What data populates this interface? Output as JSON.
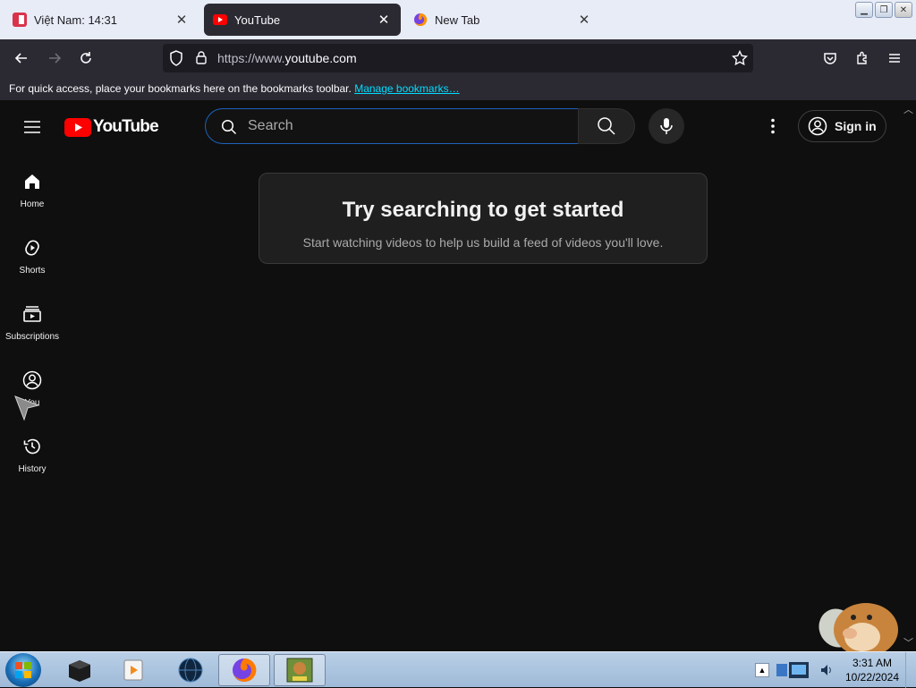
{
  "browser": {
    "tabs": [
      {
        "title": "Việt Nam: 14:31",
        "favicon": "calendar-icon",
        "active": false
      },
      {
        "title": "YouTube",
        "favicon": "youtube-icon",
        "active": true
      },
      {
        "title": "New Tab",
        "favicon": "firefox-icon",
        "active": false
      }
    ],
    "url": {
      "scheme_host_prefix": "https://www.",
      "domain": "youtube.com"
    },
    "bookmarks_bar": {
      "message": "For quick access, place your bookmarks here on the bookmarks toolbar.",
      "link": "Manage bookmarks…"
    },
    "accent": "#00ddff"
  },
  "youtube": {
    "logo_text": "YouTube",
    "search_placeholder": "Search",
    "sign_in": "Sign in",
    "guide": [
      {
        "label": "Home",
        "icon": "home-icon"
      },
      {
        "label": "Shorts",
        "icon": "shorts-icon"
      },
      {
        "label": "Subscriptions",
        "icon": "subscriptions-icon"
      },
      {
        "label": "You",
        "icon": "you-icon"
      },
      {
        "label": "History",
        "icon": "history-icon"
      }
    ],
    "prompt": {
      "title": "Try searching to get started",
      "subtitle": "Start watching videos to help us build a feed of videos you'll love."
    },
    "brand_red": "#ff0000"
  },
  "taskbar": {
    "items": [
      "start-orb",
      "black-box-app",
      "media-player",
      "globe-app",
      "firefox",
      "game-box-app"
    ],
    "clock": {
      "time": "3:31 AM",
      "date": "10/22/2024"
    }
  }
}
